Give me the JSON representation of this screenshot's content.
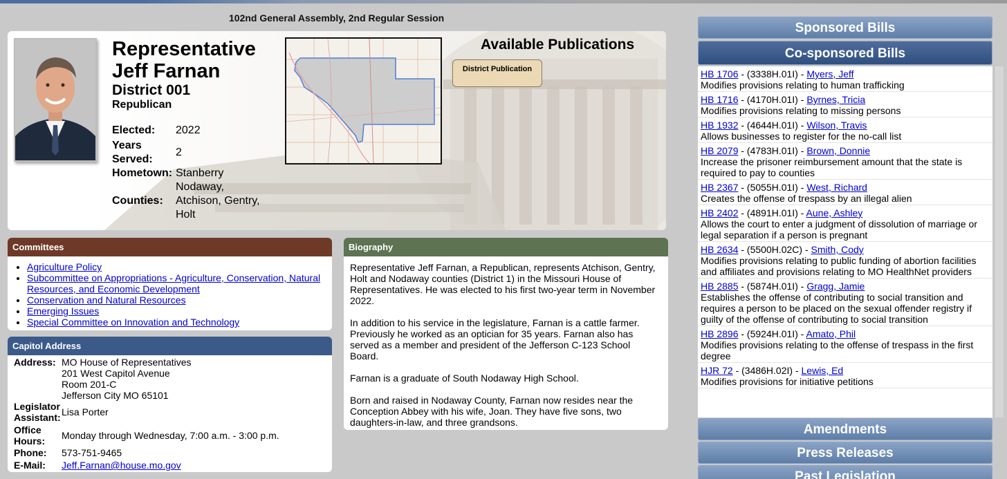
{
  "session_title": "102nd General Assembly, 2nd Regular Session",
  "profile": {
    "title": "Representative",
    "name": "Jeff Farnan",
    "district": "District 001",
    "party": "Republican",
    "elected_label": "Elected:",
    "elected": "2022",
    "years_label": "Years Served:",
    "years": "2",
    "hometown_label": "Hometown:",
    "hometown": "Stanberry",
    "counties_label": "Counties:",
    "counties": "Nodaway, Atchison, Gentry, Holt"
  },
  "publications": {
    "heading": "Available Publications",
    "button": "District Publication"
  },
  "committees": {
    "header": "Committees",
    "items": [
      "Agriculture Policy",
      "Subcommittee on Appropriations - Agriculture, Conservation, Natural Resources, and Economic Development",
      "Conservation and Natural Resources",
      "Emerging Issues",
      "Special Committee on Innovation and Technology"
    ]
  },
  "address": {
    "header": "Capitol Address",
    "address_label": "Address:",
    "address_lines": [
      "MO House of Representatives",
      "201 West Capitol Avenue",
      "Room 201-C",
      "Jefferson City MO 65101"
    ],
    "assistant_label": "Legislator Assistant:",
    "assistant": "Lisa Porter",
    "hours_label": "Office Hours:",
    "hours": "Monday through Wednesday, 7:00 a.m. - 3:00 p.m.",
    "phone_label": "Phone:",
    "phone": "573-751-9465",
    "email_label": "E-Mail:",
    "email": "Jeff.Farnan@house.mo.gov"
  },
  "biography": {
    "header": "Biography",
    "paragraphs": [
      "Representative Jeff Farnan, a Republican, represents Atchison, Gentry, Holt and Nodaway counties (District 1) in the Missouri House of Representatives. He was elected to his first two-year term in November 2022.",
      "In addition to his service in the legislature, Farnan is a cattle farmer. Previously he worked as an optician for 35 years. Farnan also has served as a member and president of the Jefferson C-123 School Board.",
      "Farnan is a graduate of South Nodaway High School.",
      "Born and raised in Nodaway County, Farnan now resides near the Conception Abbey with his wife, Joan. They have five sons, two daughters-in-law, and three grandsons."
    ]
  },
  "tabs": {
    "sponsored": "Sponsored Bills",
    "cosponsored": "Co-sponsored Bills",
    "amendments": "Amendments",
    "press": "Press Releases",
    "past": "Past Legislation"
  },
  "bills": [
    {
      "id": "HB 1706",
      "lr": " - (3338H.01I) - ",
      "sponsor": "Myers, Jeff",
      "desc": "Modifies provisions relating to human trafficking"
    },
    {
      "id": "HB 1716",
      "lr": " - (4170H.01I) - ",
      "sponsor": "Byrnes, Tricia",
      "desc": "Modifies provisions relating to missing persons"
    },
    {
      "id": "HB 1932",
      "lr": " - (4644H.01I) - ",
      "sponsor": "Wilson, Travis",
      "desc": "Allows businesses to register for the no-call list"
    },
    {
      "id": "HB 2079",
      "lr": " - (4783H.01I) - ",
      "sponsor": "Brown, Donnie",
      "desc": "Increase the prisoner reimbursement amount that the state is required to pay to counties"
    },
    {
      "id": "HB 2367",
      "lr": " - (5055H.01I) - ",
      "sponsor": "West, Richard",
      "desc": "Creates the offense of trespass by an illegal alien"
    },
    {
      "id": "HB 2402",
      "lr": " - (4891H.01I) - ",
      "sponsor": "Aune, Ashley",
      "desc": "Allows the court to enter a judgment of dissolution of marriage or legal separation if a person is pregnant"
    },
    {
      "id": "HB 2634",
      "lr": " - (5500H.02C) - ",
      "sponsor": "Smith, Cody",
      "desc": "Modifies provisions relating to public funding of abortion facilities and affiliates and provisions relating to MO HealthNet providers"
    },
    {
      "id": "HB 2885",
      "lr": " - (5874H.01I) - ",
      "sponsor": "Gragg, Jamie",
      "desc": "Establishes the offense of contributing to social transition and requires a person to be placed on the sexual offender registry if guilty of the offense of contributing to social transition"
    },
    {
      "id": "HB 2896",
      "lr": " - (5924H.01I) - ",
      "sponsor": "Amato, Phil",
      "desc": "Modifies provisions relating to the offense of trespass in the first degree"
    },
    {
      "id": "HJR 72",
      "lr": " - (3486H.02I) - ",
      "sponsor": "Lewis, Ed",
      "desc": "Modifies provisions for initiative petitions"
    }
  ]
}
